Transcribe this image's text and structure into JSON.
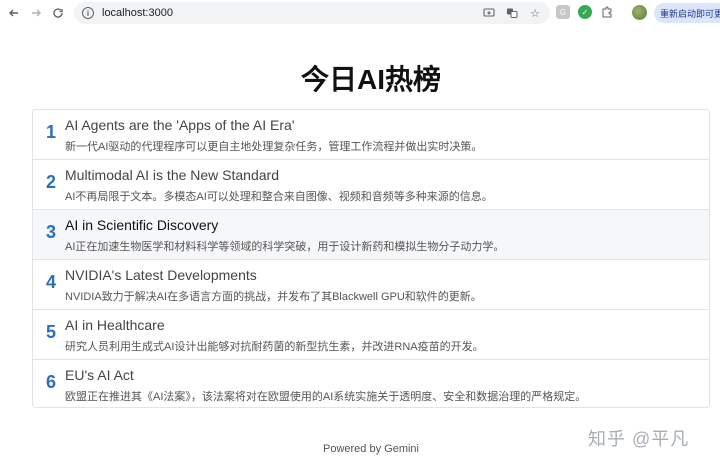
{
  "browser": {
    "url": "localhost:3000",
    "update_label": "重新启动即可更新"
  },
  "page": {
    "title": "今日AI热榜",
    "footer": "Powered by Gemini"
  },
  "items": [
    {
      "rank": "1",
      "title": "AI Agents are the 'Apps of the AI Era'",
      "desc": "新一代AI驱动的代理程序可以更自主地处理复杂任务，管理工作流程并做出实时决策。"
    },
    {
      "rank": "2",
      "title": "Multimodal AI is the New Standard",
      "desc": "AI不再局限于文本。多模态AI可以处理和整合来自图像、视频和音频等多种来源的信息。"
    },
    {
      "rank": "3",
      "title": "AI in Scientific Discovery",
      "desc": "AI正在加速生物医学和材料科学等领域的科学突破，用于设计新药和模拟生物分子动力学。"
    },
    {
      "rank": "4",
      "title": "NVIDIA's Latest Developments",
      "desc": "NVIDIA致力于解决AI在多语言方面的挑战，并发布了其Blackwell GPU和软件的更新。"
    },
    {
      "rank": "5",
      "title": "AI in Healthcare",
      "desc": "研究人员利用生成式AI设计出能够对抗耐药菌的新型抗生素，并改进RNA疫苗的开发。"
    },
    {
      "rank": "6",
      "title": "EU's AI Act",
      "desc": "欧盟正在推进其《AI法案》，该法案将对在欧盟使用的AI系统实施关于透明度、安全和数据治理的严格规定。"
    }
  ],
  "watermark": "知乎 @平凡",
  "colors": {
    "rank": "#2a6ebf",
    "highlight_row": "#f6f7f9"
  }
}
